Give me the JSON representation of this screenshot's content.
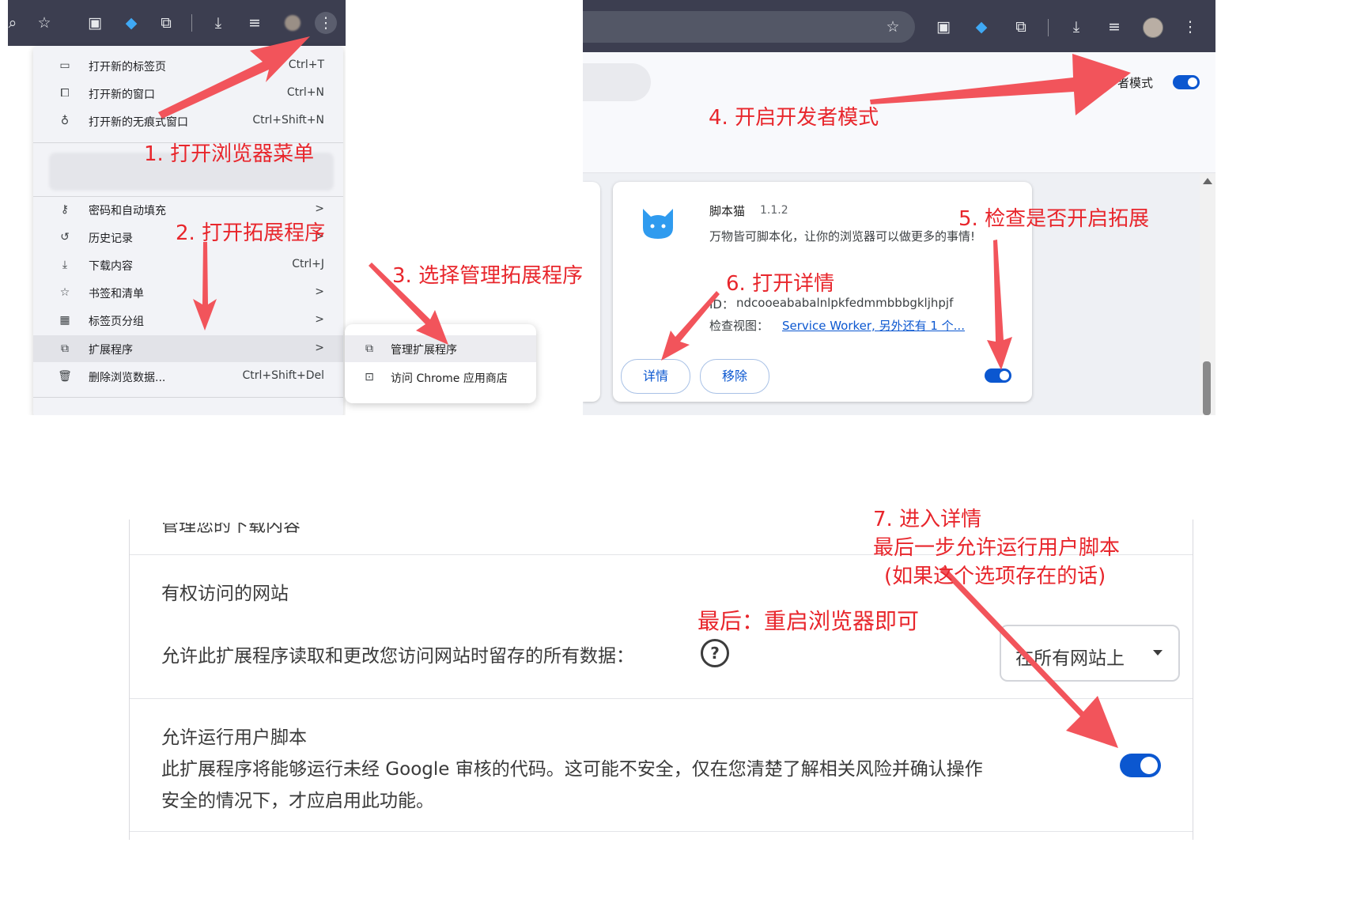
{
  "panel_menu": {
    "items": [
      {
        "label": "打开新的标签页",
        "shortcut": "Ctrl+T",
        "icon": "new-tab-icon"
      },
      {
        "label": "打开新的窗口",
        "shortcut": "Ctrl+N",
        "icon": "new-window-icon"
      },
      {
        "label": "打开新的无痕式窗口",
        "shortcut": "Ctrl+Shift+N",
        "icon": "incognito-icon"
      },
      {
        "label": "密码和自动填充",
        "shortcut": ">",
        "icon": "key-icon"
      },
      {
        "label": "历史记录",
        "shortcut": ">",
        "icon": "history-icon"
      },
      {
        "label": "下载内容",
        "shortcut": "Ctrl+J",
        "icon": "download-icon"
      },
      {
        "label": "书签和清单",
        "shortcut": ">",
        "icon": "star-icon"
      },
      {
        "label": "标签页分组",
        "shortcut": ">",
        "icon": "grid-icon"
      },
      {
        "label": "扩展程序",
        "shortcut": ">",
        "icon": "puzzle-icon"
      },
      {
        "label": "删除浏览数据...",
        "shortcut": "Ctrl+Shift+Del",
        "icon": "trash-icon"
      }
    ],
    "submenu": [
      {
        "label": "管理扩展程序",
        "icon": "puzzle-icon"
      },
      {
        "label": "访问 Chrome 应用商店",
        "icon": "store-icon"
      }
    ]
  },
  "panel_extensions": {
    "dev_mode_label": "者模式",
    "extension": {
      "name": "脚本猫",
      "version": "1.1.2",
      "description": "万物皆可脚本化，让你的浏览器可以做更多的事情!",
      "id_label": "ID：",
      "id_value": "ndcooeababalnlpkfedmmbbbgkljhpjf",
      "inspect_label": "检查视图：",
      "inspect_link": "Service Worker, 另外还有 1 个...",
      "details_button": "详情",
      "remove_button": "移除"
    }
  },
  "panel_details": {
    "cut_text": "管理您的下载内容",
    "site_access_title": "有权访问的网站",
    "site_access_desc": "允许此扩展程序读取和更改您访问网站时留存的所有数据：",
    "site_access_value": "在所有网站上",
    "user_scripts_title": "允许运行用户脚本",
    "user_scripts_desc_1": "此扩展程序将能够运行未经 Google 审核的代码。这可能不安全，仅在您清楚了解相关风险并确认操作",
    "user_scripts_desc_2": "安全的情况下，才应启用此功能。"
  },
  "annotations": {
    "step1": "1. 打开浏览器菜单",
    "step2": "2. 打开拓展程序",
    "step3": "3. 选择管理拓展程序",
    "step4": "4. 开启开发者模式",
    "step5": "5. 检查是否开启拓展",
    "step6": "6. 打开详情",
    "step7_line1": "7. 进入详情",
    "step7_line2": "最后一步允许运行用户脚本",
    "step7_line3": "(如果这个选项存在的话)",
    "final": "最后：重启浏览器即可"
  },
  "colors": {
    "annotation": "#e8262c",
    "arrow": "#f2545b",
    "toolbar": "#3c3e50",
    "accent": "#0b57d0"
  }
}
